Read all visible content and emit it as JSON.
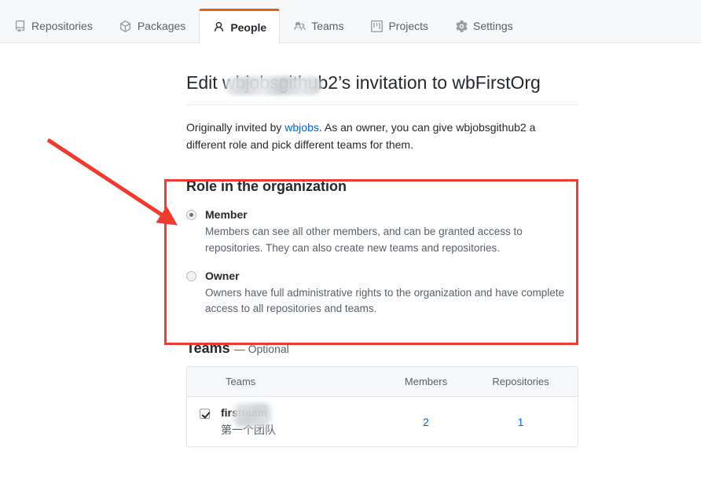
{
  "tabs": [
    {
      "id": "repositories",
      "label": "Repositories",
      "icon": "repo-icon",
      "active": false
    },
    {
      "id": "packages",
      "label": "Packages",
      "icon": "package-icon",
      "active": false
    },
    {
      "id": "people",
      "label": "People",
      "icon": "person-icon",
      "active": true
    },
    {
      "id": "teams",
      "label": "Teams",
      "icon": "teams-icon",
      "active": false
    },
    {
      "id": "projects",
      "label": "Projects",
      "icon": "project-icon",
      "active": false
    },
    {
      "id": "settings",
      "label": "Settings",
      "icon": "gear-icon",
      "active": false
    }
  ],
  "page": {
    "title": "Edit wbjobsgithub2’s invitation to wbFirstOrg",
    "lede_prefix": "Originally invited by ",
    "lede_link": "wbjobs",
    "lede_suffix": ". As an owner, you can give wbjobsgithub2 a different role and pick different teams for them."
  },
  "role": {
    "section_title": "Role in the organization",
    "options": [
      {
        "id": "member",
        "label": "Member",
        "description": "Members can see all other members, and can be granted access to repositories. They can also create new teams and repositories.",
        "selected": true
      },
      {
        "id": "owner",
        "label": "Owner",
        "description": "Owners have full administrative rights to the organization and have complete access to all repositories and teams.",
        "selected": false
      }
    ]
  },
  "teams": {
    "heading": "Teams",
    "heading_optional": "— Optional",
    "columns": {
      "teams": "Teams",
      "members": "Members",
      "repositories": "Repositories"
    },
    "rows": [
      {
        "name": "firstteam",
        "description": "第一个团队",
        "members": "2",
        "repositories": "1",
        "checked": true
      }
    ]
  },
  "annotations": {
    "highlight_color": "#ef3b36",
    "arrow_color": "#f0392f"
  },
  "theme": {
    "accent": "#e36209",
    "link": "#0366d6",
    "text": "#24292e",
    "muted": "#586069",
    "border": "#e1e4e8",
    "tabbar_bg": "#f6f8fa"
  }
}
